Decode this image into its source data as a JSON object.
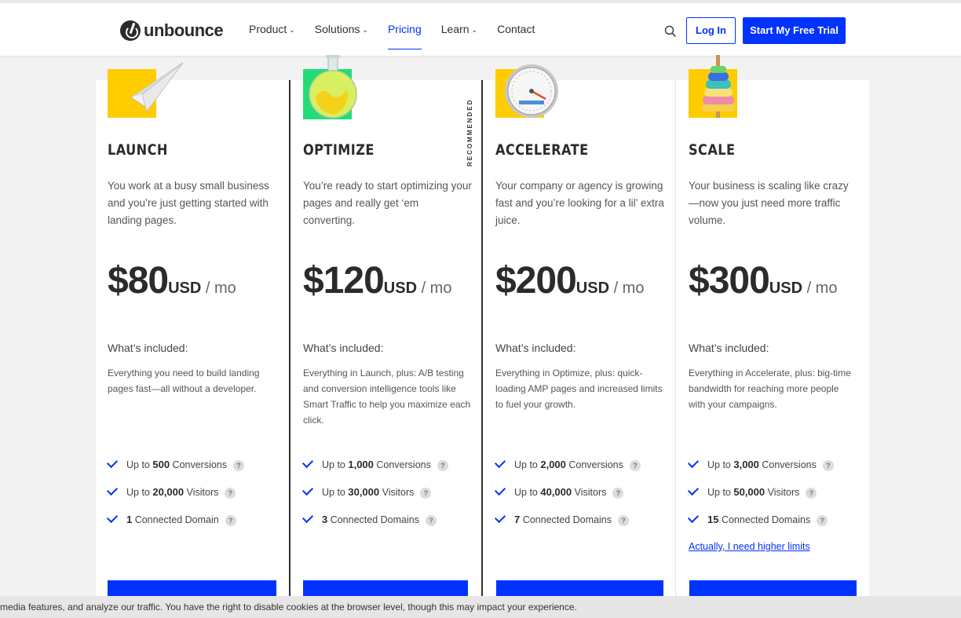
{
  "nav": {
    "logo_text": "unbounce",
    "items": [
      {
        "label": "Product",
        "chevron": "⌄",
        "active": false
      },
      {
        "label": "Solutions",
        "chevron": "⌄",
        "active": false
      },
      {
        "label": "Pricing",
        "chevron": "",
        "active": true
      },
      {
        "label": "Learn",
        "chevron": "⌄",
        "active": false
      },
      {
        "label": "Contact",
        "chevron": "",
        "active": false
      }
    ],
    "login_label": "Log In",
    "trial_label": "Start My Free Trial",
    "search_icon": "search-icon"
  },
  "colors": {
    "accent": "#0033ff",
    "image_yellow": "#ffcc00",
    "image_green": "#22dd77"
  },
  "plans": [
    {
      "name": "LAUNCH",
      "description": "You work at a busy small business and you’re just getting started with landing pages.",
      "price": "$80",
      "currency": "USD",
      "period": " / mo",
      "included_title": "What’s included:",
      "included_desc": "Everything you need to build landing pages fast—all without a developer.",
      "features": [
        {
          "prefix": "Up to ",
          "num": "500",
          "suffix": " Conversions"
        },
        {
          "prefix": "Up to ",
          "num": "20,000",
          "suffix": " Visitors"
        },
        {
          "prefix": "",
          "num": "1",
          "suffix": " Connected Domain"
        }
      ],
      "icon": "paper-plane-icon"
    },
    {
      "name": "OPTIMIZE",
      "description": "You’re ready to start optimizing your pages and really get ‘em converting.",
      "price": "$120",
      "currency": "USD",
      "period": " / mo",
      "included_title": "What’s included:",
      "included_desc": "Everything in Launch, plus: A/B testing and conversion intelligence tools like Smart Traffic to help you maximize each click.",
      "features": [
        {
          "prefix": "Up to ",
          "num": "1,000",
          "suffix": " Conversions"
        },
        {
          "prefix": "Up to ",
          "num": "30,000",
          "suffix": " Visitors"
        },
        {
          "prefix": "",
          "num": "3",
          "suffix": " Connected Domains"
        }
      ],
      "recommended_label": "RECOMMENDED",
      "icon": "flask-icon"
    },
    {
      "name": "ACCELERATE",
      "description": "Your company or agency is growing fast and you’re looking for a lil’ extra juice.",
      "price": "$200",
      "currency": "USD",
      "period": " / mo",
      "included_title": "What’s included:",
      "included_desc": "Everything in Optimize, plus: quick-loading AMP pages and increased limits to fuel your growth.",
      "features": [
        {
          "prefix": "Up to ",
          "num": "2,000",
          "suffix": " Conversions"
        },
        {
          "prefix": "Up to ",
          "num": "40,000",
          "suffix": " Visitors"
        },
        {
          "prefix": "",
          "num": "7",
          "suffix": " Connected Domains"
        }
      ],
      "icon": "speedometer-icon"
    },
    {
      "name": "SCALE",
      "description": "Your business is scaling like crazy—now you just need more traffic volume.",
      "price": "$300",
      "currency": "USD",
      "period": " / mo",
      "included_title": "What’s included:",
      "included_desc": "Everything in Accelerate, plus: big-time bandwidth for reaching more people with your campaigns.",
      "features": [
        {
          "prefix": "Up to ",
          "num": "3,000",
          "suffix": " Conversions"
        },
        {
          "prefix": "Up to ",
          "num": "50,000",
          "suffix": " Visitors"
        },
        {
          "prefix": "",
          "num": "15",
          "suffix": " Connected Domains"
        }
      ],
      "limits_link": "Actually, I need higher limits",
      "icon": "ring-stack-icon"
    }
  ],
  "help_glyph": "?",
  "cookie_text": "media features, and analyze our traffic. You have the right to disable cookies at the browser level, though this may impact your experience."
}
